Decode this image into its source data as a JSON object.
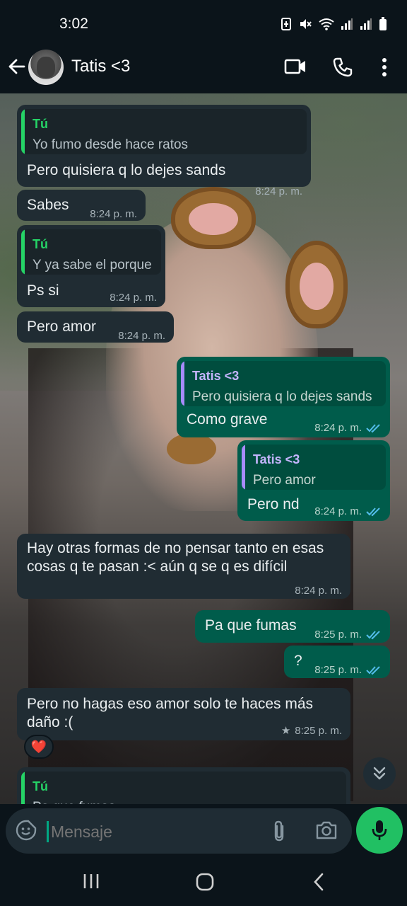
{
  "status_bar": {
    "time": "3:02"
  },
  "header": {
    "contact_name": "Tatis <3"
  },
  "messages": [
    {
      "dir": "in",
      "quote_author": "Tú",
      "quote_text": "Yo fumo desde hace ratos",
      "text": "Pero quisiera q lo dejes sands",
      "time": "8:24 p. m."
    },
    {
      "dir": "in",
      "text": "Sabes",
      "time": "8:24 p. m."
    },
    {
      "dir": "in",
      "quote_author": "Tú",
      "quote_text": "Y ya sabe el porque",
      "text": "Ps si",
      "time": "8:24 p. m."
    },
    {
      "dir": "in",
      "text": "Pero amor",
      "time": "8:24 p. m."
    },
    {
      "dir": "out",
      "quote_author": "Tatis <3",
      "quote_text": "Pero quisiera q lo dejes sands",
      "text": "Como grave",
      "time": "8:24 p. m."
    },
    {
      "dir": "out",
      "quote_author": "Tatis <3",
      "quote_text": "Pero amor",
      "text": "Pero nd",
      "time": "8:24 p. m."
    },
    {
      "dir": "in",
      "text_line1": "Hay otras formas de no pensar tanto en esas",
      "text_line2": "cosas q te pasan :< aún q se q es difícil",
      "time": "8:24 p. m."
    },
    {
      "dir": "out",
      "text": "Pa que fumas",
      "time": "8:25 p. m."
    },
    {
      "dir": "out",
      "text": "?",
      "time": "8:25 p. m."
    },
    {
      "dir": "in",
      "text_line1": "Pero no hagas eso amor solo te haces más",
      "text_line2": "daño :(",
      "time": "8:25 p. m.",
      "starred": "★",
      "reaction": "❤️"
    },
    {
      "dir": "in",
      "quote_author": "Tú",
      "quote_text": "Pa que fumas"
    }
  ],
  "composer": {
    "placeholder": "Mensaje"
  },
  "colors": {
    "quote_you": "#25d366",
    "quote_contact": "#a78bfa",
    "read_ticks": "#53bdeb",
    "accent": "#21c063"
  }
}
